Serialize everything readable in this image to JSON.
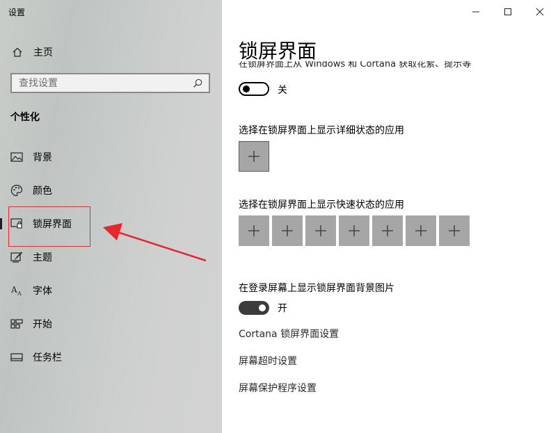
{
  "sidebar": {
    "app_title": "设置",
    "home_label": "主页",
    "search_placeholder": "查找设置",
    "section_title": "个性化",
    "items": [
      {
        "label": "背景",
        "icon": "picture-icon"
      },
      {
        "label": "颜色",
        "icon": "palette-icon"
      },
      {
        "label": "锁屏界面",
        "icon": "lock-screen-icon",
        "selected": true
      },
      {
        "label": "主题",
        "icon": "theme-brush-icon"
      },
      {
        "label": "字体",
        "icon": "font-icon"
      },
      {
        "label": "开始",
        "icon": "start-tiles-icon"
      },
      {
        "label": "任务栏",
        "icon": "taskbar-icon"
      }
    ]
  },
  "window_controls": {
    "minimize": "minimize-icon",
    "maximize": "maximize-icon",
    "close": "close-icon"
  },
  "main": {
    "title": "锁屏界面",
    "clipped_text": "在锁屏界面上从 Windows 和 Cortana 获取花絮、提示等",
    "toggle1": {
      "state": "off",
      "label": "关"
    },
    "detailed_status_label": "选择在锁屏界面上显示详细状态的应用",
    "quick_status_label": "选择在锁屏界面上显示快速状态的应用",
    "quick_status_tile_count": 7,
    "login_bg_label": "在登录屏幕上显示锁屏界面背景图片",
    "toggle2": {
      "state": "on",
      "label": "开"
    },
    "links": [
      "Cortana 锁屏界面设置",
      "屏幕超时设置",
      "屏幕保护程序设置"
    ]
  },
  "colors": {
    "annotation_red": "#e8262b",
    "tile_gray": "#a6a6a6",
    "toggle_on": "#3c3c3c"
  }
}
